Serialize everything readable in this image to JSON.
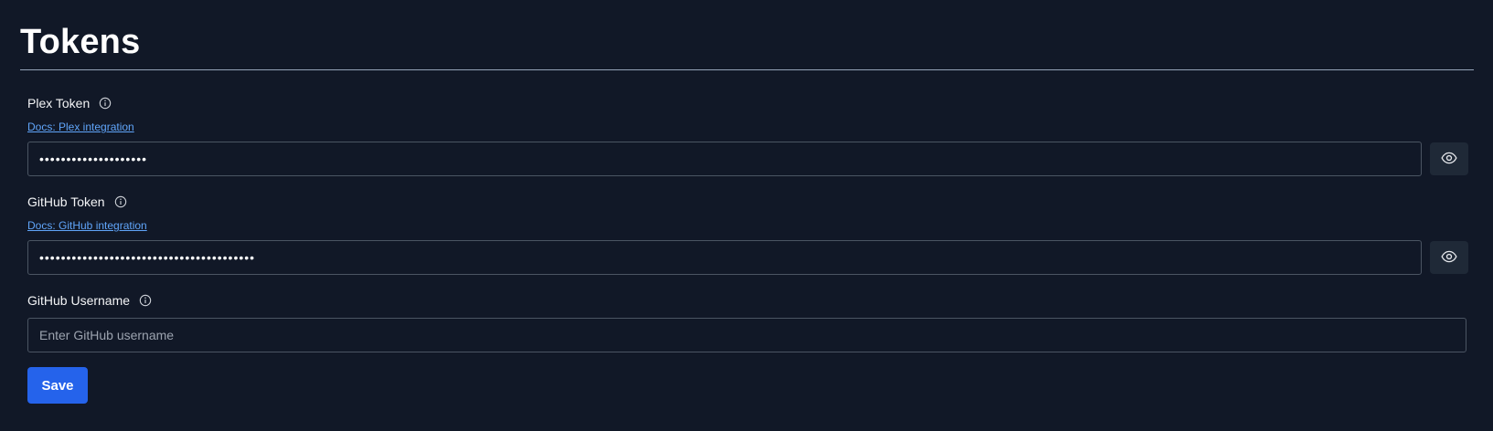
{
  "page": {
    "title": "Tokens"
  },
  "fields": {
    "plex": {
      "label": "Plex Token",
      "docs_link": "Docs: Plex integration",
      "value": "••••••••••••••••••••"
    },
    "github": {
      "label": "GitHub Token",
      "docs_link": "Docs: GitHub integration",
      "value": "••••••••••••••••••••••••••••••••••••••••"
    },
    "github_username": {
      "label": "GitHub Username",
      "value": "",
      "placeholder": "Enter GitHub username"
    }
  },
  "actions": {
    "save_label": "Save"
  },
  "icons": {
    "info": "info-circle-icon",
    "reveal": "eye-icon"
  },
  "colors": {
    "background": "#111827",
    "accent": "#2563eb",
    "link": "#60a5fa"
  }
}
